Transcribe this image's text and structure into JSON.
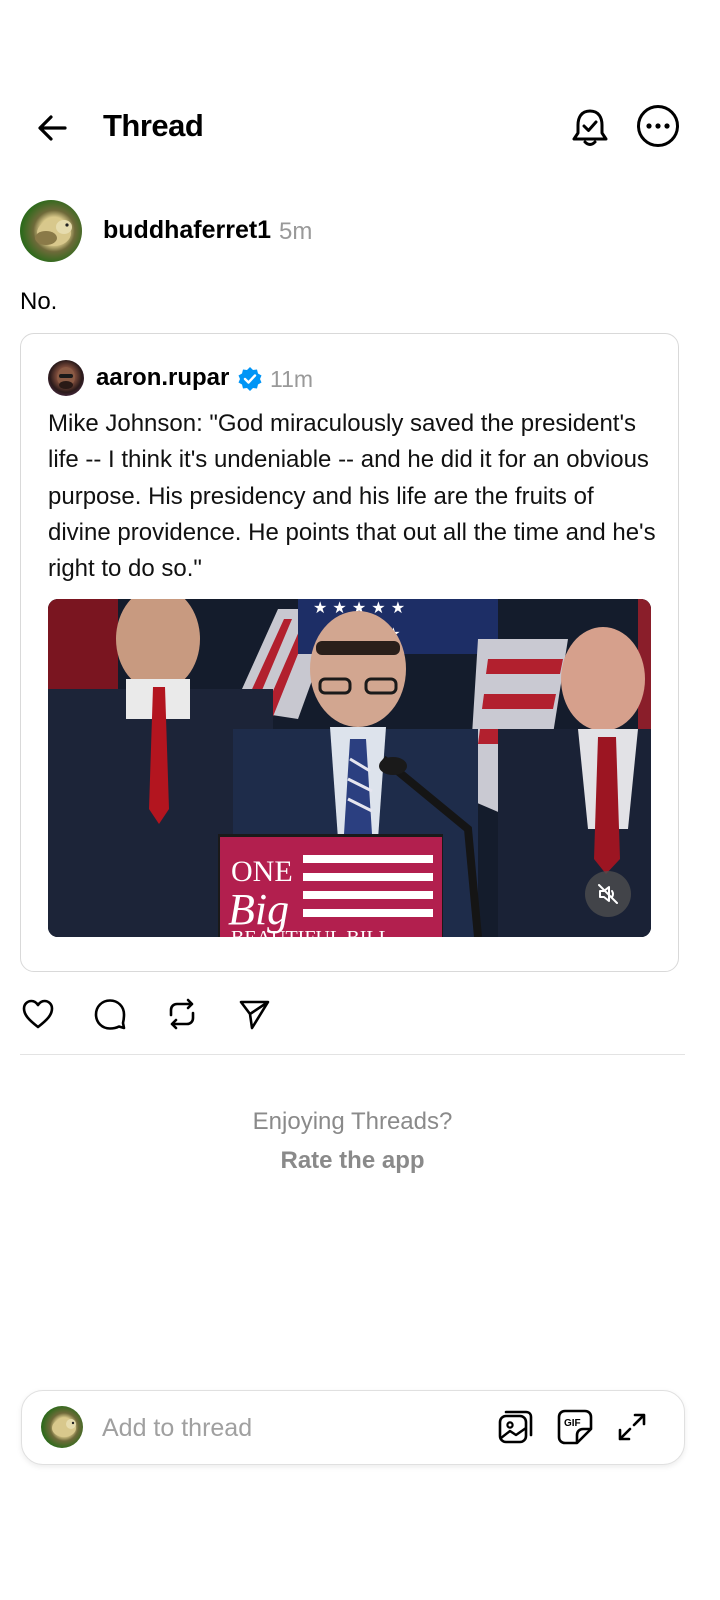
{
  "header": {
    "title": "Thread",
    "back_icon": "arrow-left-icon",
    "bell_icon": "bell-check-icon",
    "more_icon": "more-horizontal-icon"
  },
  "post": {
    "author": "buddhaferret1",
    "time": "5m",
    "text": "No."
  },
  "quoted_post": {
    "author": "aaron.rupar",
    "verified": true,
    "verified_color": "#0095f6",
    "time": "11m",
    "text": "Mike Johnson: \"God miraculously saved the president's life -- I think it's undeniable -- and he did it for an obvious purpose. His presidency and his life are the fruits of divine providence. He points that out all the time and he's right to do so.\"",
    "video": {
      "podium_line1": "ONE",
      "podium_line2": "Big",
      "podium_line3": "BEAUTIFUL BILL",
      "muted_icon": "volume-mute-icon"
    }
  },
  "actions": [
    {
      "name": "like",
      "icon": "heart-icon"
    },
    {
      "name": "reply",
      "icon": "comment-icon"
    },
    {
      "name": "repost",
      "icon": "repost-icon"
    },
    {
      "name": "share",
      "icon": "send-icon"
    }
  ],
  "prompt": {
    "question": "Enjoying Threads?",
    "cta": "Rate the app"
  },
  "composer": {
    "placeholder": "Add to thread",
    "icons": [
      "image-icon",
      "gif-icon",
      "expand-icon"
    ]
  }
}
